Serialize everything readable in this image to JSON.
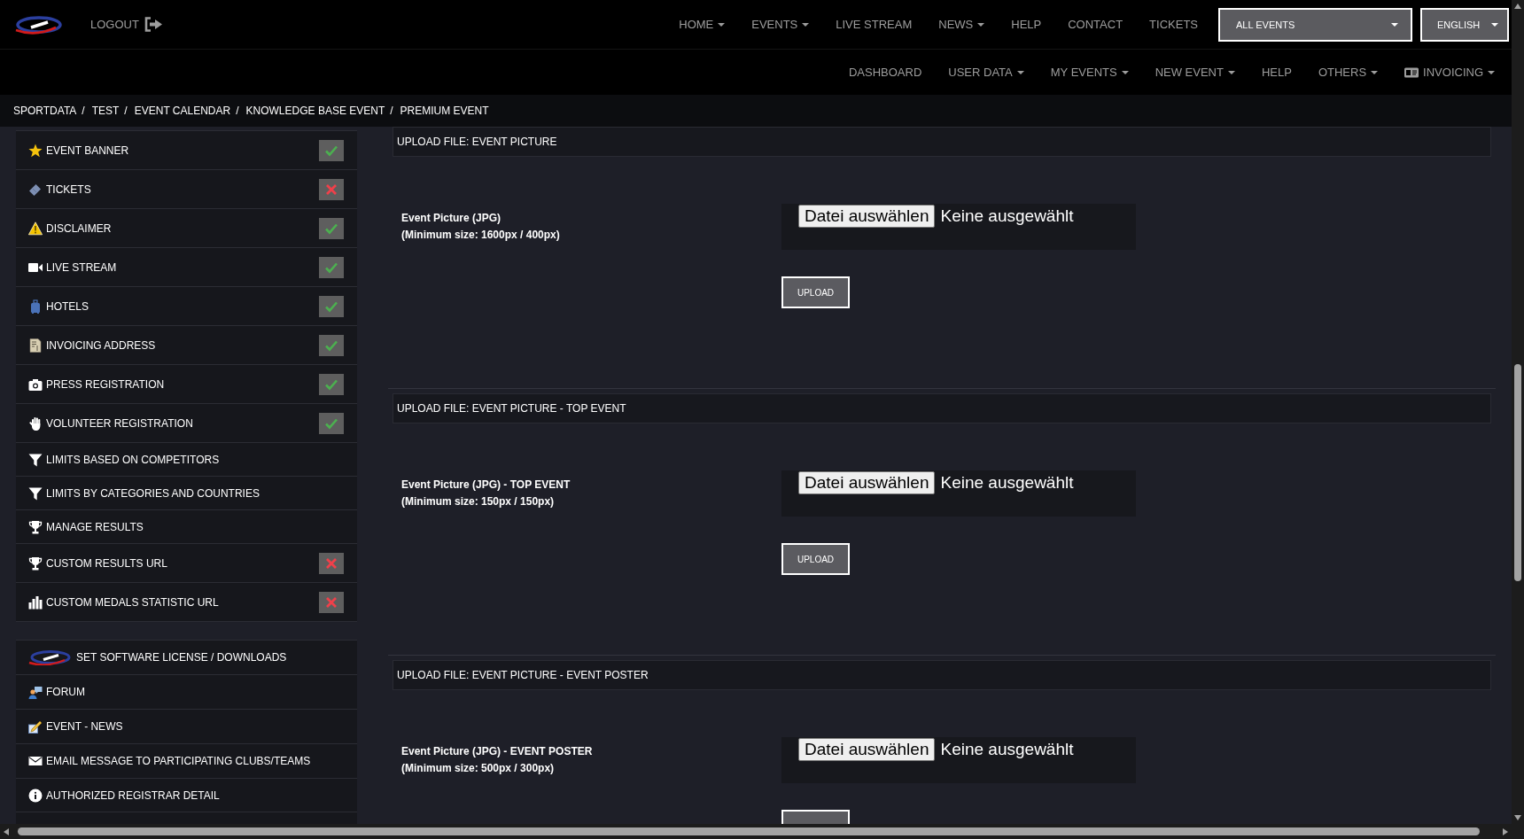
{
  "header": {
    "logout": "LOGOUT",
    "menu": [
      {
        "label": "HOME",
        "dropdown": true
      },
      {
        "label": "EVENTS",
        "dropdown": true
      },
      {
        "label": "LIVE STREAM",
        "dropdown": false
      },
      {
        "label": "NEWS",
        "dropdown": true
      },
      {
        "label": "HELP",
        "dropdown": false
      },
      {
        "label": "CONTACT",
        "dropdown": false
      },
      {
        "label": "TICKETS",
        "dropdown": false
      }
    ],
    "selects": [
      {
        "value": "ALL EVENTS"
      },
      {
        "value": "ENGLISH"
      }
    ]
  },
  "sub_menu": [
    {
      "label": "DASHBOARD",
      "dropdown": false
    },
    {
      "label": "USER DATA",
      "dropdown": true
    },
    {
      "label": "MY EVENTS",
      "dropdown": true
    },
    {
      "label": "NEW EVENT",
      "dropdown": true
    },
    {
      "label": "HELP",
      "dropdown": false
    },
    {
      "label": "OTHERS",
      "dropdown": true
    },
    {
      "label": "INVOICING",
      "dropdown": true
    }
  ],
  "breadcrumb": [
    {
      "label": "SPORTDATA",
      "separator": "/"
    },
    {
      "label": "TEST",
      "separator": "/"
    },
    {
      "label": "EVENT CALENDAR",
      "separator": "/"
    },
    {
      "label": "KNOWLEDGE BASE EVENT",
      "separator": "/"
    },
    {
      "label": "PREMIUM EVENT"
    }
  ],
  "sidebar": {
    "groups": [
      {
        "items": [
          {
            "label": "EVENT BANNER",
            "complete": true
          },
          {
            "label": "TICKETS",
            "complete": false
          },
          {
            "label": "DISCLAIMER",
            "complete": true
          },
          {
            "label": "LIVE STREAM",
            "complete": true
          },
          {
            "label": "HOTELS",
            "complete": true
          },
          {
            "label": "INVOICING ADDRESS",
            "complete": true
          },
          {
            "label": "PRESS REGISTRATION",
            "complete": true
          },
          {
            "label": "VOLUNTEER REGISTRATION",
            "complete": true
          },
          {
            "label": "LIMITS BASED ON COMPETITORS"
          },
          {
            "label": "LIMITS BY CATEGORIES AND COUNTRIES"
          },
          {
            "label": "MANAGE RESULTS"
          },
          {
            "label": "CUSTOM RESULTS URL",
            "complete": false
          },
          {
            "label": "CUSTOM MEDALS STATISTIC URL",
            "complete": false
          }
        ]
      },
      {
        "items": [
          {
            "label": "SET SOFTWARE LICENSE / DOWNLOADS"
          },
          {
            "label": "FORUM"
          },
          {
            "label": "EVENT - NEWS"
          },
          {
            "label": "EMAIL MESSAGE TO PARTICIPATING CLUBS/TEAMS"
          },
          {
            "label": "AUTHORIZED REGISTRAR DETAIL"
          }
        ]
      }
    ]
  },
  "uploads": [
    {
      "title": "UPLOAD FILE: EVENT PICTURE",
      "label": "Event Picture (JPG)",
      "hint": "(Minimum size: 1600px / 400px)",
      "choose_button": "Datei auswählen",
      "file_status": "Keine ausgewählt",
      "upload_button": "UPLOAD"
    },
    {
      "title": "UPLOAD FILE: EVENT PICTURE - TOP EVENT",
      "label": "Event Picture (JPG) - TOP EVENT",
      "hint": "(Minimum size: 150px / 150px)",
      "choose_button": "Datei auswählen",
      "file_status": "Keine ausgewählt",
      "upload_button": "UPLOAD"
    },
    {
      "title": "UPLOAD FILE: EVENT PICTURE - EVENT POSTER",
      "label": "Event Picture (JPG) - EVENT POSTER",
      "hint": "(Minimum size: 500px / 300px)",
      "choose_button": "Datei auswählen",
      "file_status": "Keine ausgewählt"
    }
  ]
}
